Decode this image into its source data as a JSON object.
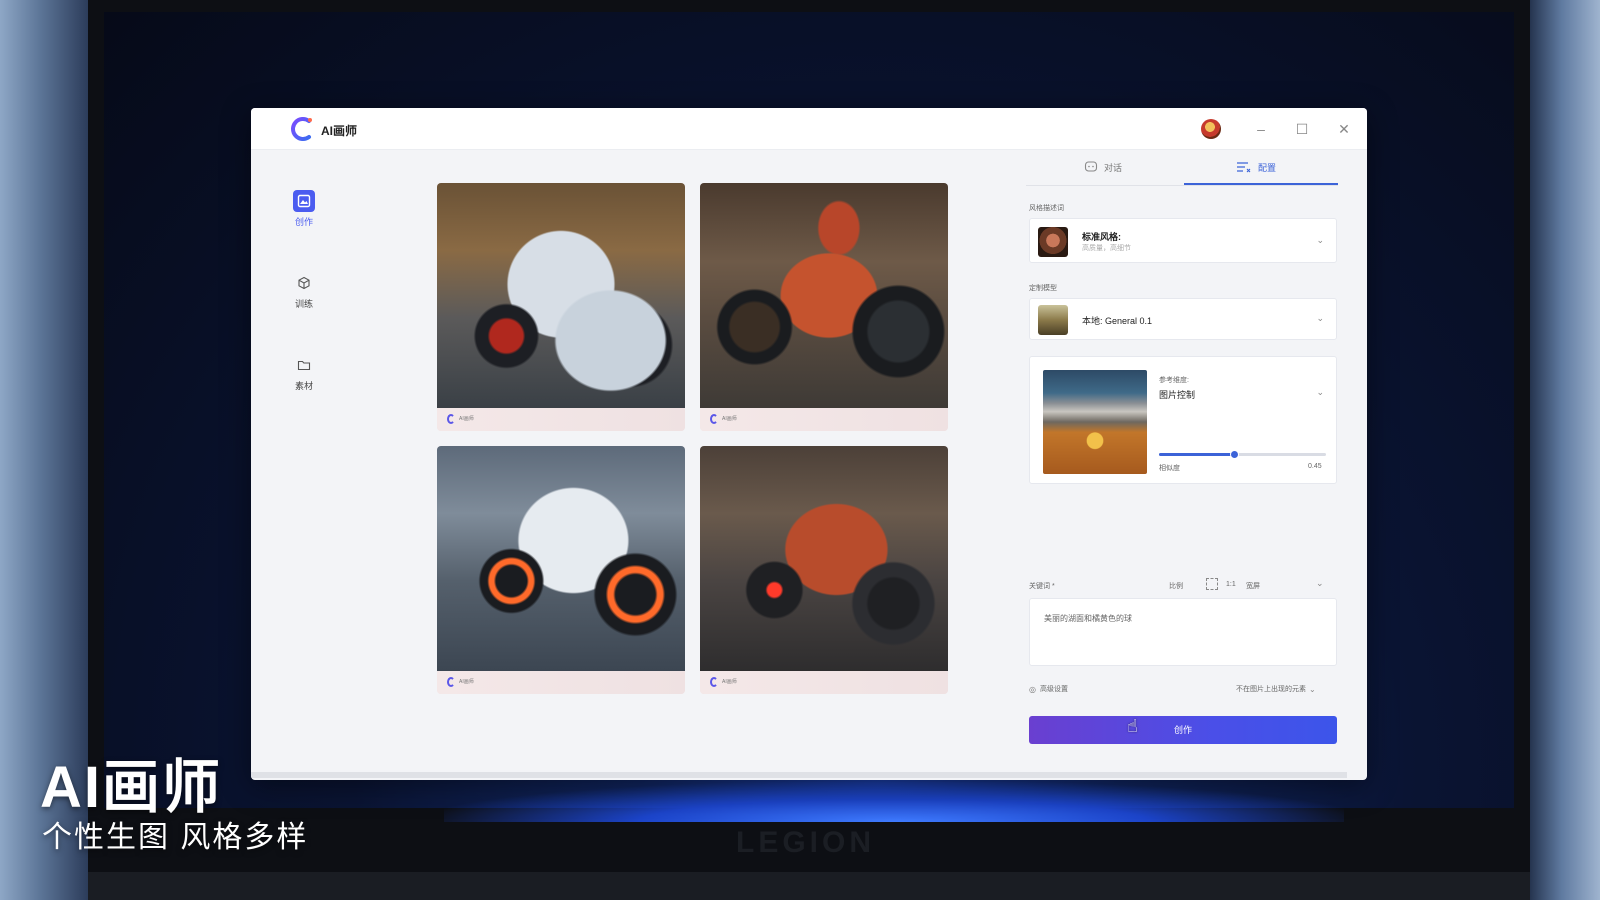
{
  "app": {
    "title": "AI画师",
    "brand_color": "#4b5cf0"
  },
  "titlebar": {
    "minimize_icon": "minimize-icon",
    "maximize_icon": "maximize-icon",
    "close_icon": "close-icon"
  },
  "nav": {
    "items": [
      {
        "label": "创作",
        "icon": "image-create-icon",
        "active": true
      },
      {
        "label": "训练",
        "icon": "cube-icon",
        "active": false
      },
      {
        "label": "素材",
        "icon": "folder-icon",
        "active": false
      }
    ]
  },
  "gallery": {
    "images": [
      {
        "description_icon": "motorcycle-image-silver-red",
        "mark": "AI画师"
      },
      {
        "description_icon": "motorcycle-image-copper",
        "mark": "AI画师"
      },
      {
        "description_icon": "motorcycle-image-white-neon",
        "mark": "AI画师"
      },
      {
        "description_icon": "motorcycle-image-red-dark",
        "mark": "AI画师"
      }
    ]
  },
  "panel": {
    "tabs": [
      {
        "label": "对话",
        "icon": "chat-icon",
        "active": false
      },
      {
        "label": "配置",
        "icon": "config-icon",
        "active": true
      }
    ],
    "style_section": {
      "label": "风格描述词",
      "title": "标准风格:",
      "subtitle": "高质量，高细节"
    },
    "model_section": {
      "label": "定制模型",
      "value": "本地: General 0.1"
    },
    "reference": {
      "label": "参考维度:",
      "value": "图片控制",
      "slider_label": "相似度",
      "slider_value": "0.45",
      "slider_fraction": 0.45
    },
    "keywords": {
      "label": "关键词 *",
      "ratio_label": "比例",
      "ratio_value": "1:1",
      "ratio_mode": "宽屏",
      "prompt": "美丽的湖面和橘黄色的球"
    },
    "advanced": {
      "label": "高级设置",
      "right_label": "不在图片上出现的元素"
    },
    "create_button": "创作"
  },
  "overlay": {
    "title": "AI画师",
    "subtitle": "个性生图 风格多样"
  },
  "device": {
    "brand": "LEGION"
  }
}
